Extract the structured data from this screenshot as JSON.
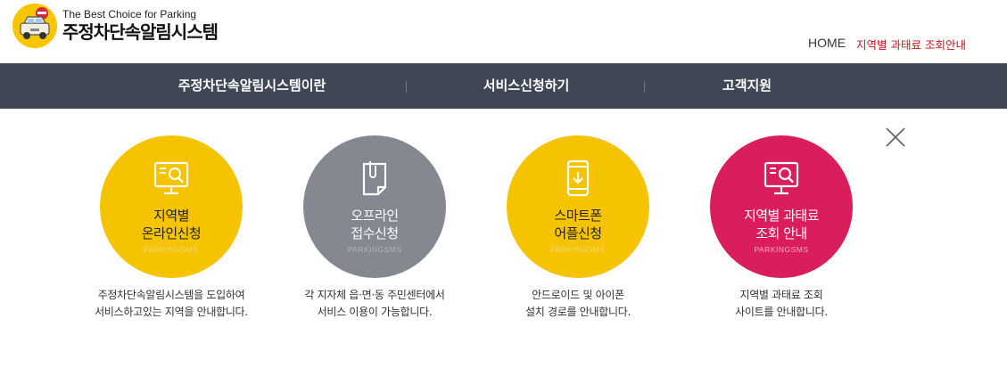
{
  "header": {
    "tagline": "The Best Choice for Parking",
    "title": "주정차단속알림시스템",
    "links": {
      "home": "HOME",
      "region": "지역별 과태료 조회안내"
    }
  },
  "nav": {
    "items": [
      {
        "label": "주정차단속알림시스템이란"
      },
      {
        "label": "서비스신청하기"
      },
      {
        "label": "고객지원"
      }
    ]
  },
  "cards": [
    {
      "line1": "지역별",
      "line2": "온라인신청",
      "sub": "PARKINGSMS",
      "desc1": "주정차단속알림시스템을 도입하여",
      "desc2": "서비스하고있는 지역을 안내합니다.",
      "color": "#f6c300",
      "icon": "monitor-search-icon"
    },
    {
      "line1": "오프라인",
      "line2": "접수신청",
      "sub": "PARKINGSMS",
      "desc1": "각 지자체 읍·면·동 주민센터에서",
      "desc2": "서비스 이용이 가능합니다.",
      "color": "#838891",
      "icon": "clipped-document-icon"
    },
    {
      "line1": "스마트폰",
      "line2": "어플신청",
      "sub": "PARKINGSMS",
      "desc1": "안드로이드 및 아이폰",
      "desc2": "설치 경로를 안내합니다.",
      "color": "#f6c300",
      "icon": "smartphone-download-icon"
    },
    {
      "line1": "지역별 과태료",
      "line2": "조회 안내",
      "sub": "PARKINGSMS",
      "desc1": "지역별 과태료 조회",
      "desc2": "사이트를 안내합니다.",
      "color": "#d91e5b",
      "icon": "monitor-search-icon"
    }
  ],
  "colors": {
    "nav_bg": "#3f4757",
    "accent_red": "#c4161c",
    "yellow": "#f6c300",
    "gray": "#838891",
    "pink": "#d91e5b"
  }
}
